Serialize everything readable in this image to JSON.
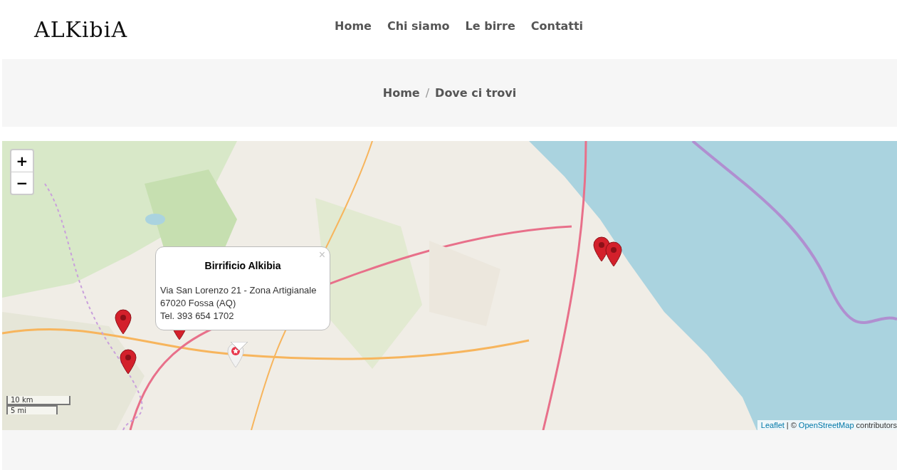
{
  "logo": "ALKibiA",
  "nav": [
    {
      "label": "Home"
    },
    {
      "label": "Chi siamo"
    },
    {
      "label": "Le birre"
    },
    {
      "label": "Contatti"
    }
  ],
  "breadcrumb": {
    "items": [
      "Home",
      "Dove ci trovi"
    ],
    "separator": "/"
  },
  "map": {
    "kind": "picture",
    "zoom": {
      "in": "+",
      "out": "−"
    },
    "popup": {
      "title": "Birrificio Alkibia",
      "lines": [
        "Via San Lorenzo 21 - Zona Artigianale",
        "67020 Fossa (AQ)",
        "Tel. 393 654 1702"
      ],
      "close": "×"
    },
    "markers": [
      {
        "kind": "pin"
      },
      {
        "kind": "pin"
      },
      {
        "kind": "pin"
      },
      {
        "kind": "pin"
      },
      {
        "kind": "pin"
      },
      {
        "kind": "home"
      }
    ],
    "scale": [
      "10 km",
      "5 mi"
    ],
    "attribution": {
      "link1": "Leaflet",
      "separator": "| ©",
      "link2": "OpenStreetMap",
      "suffix": "contributors"
    }
  }
}
